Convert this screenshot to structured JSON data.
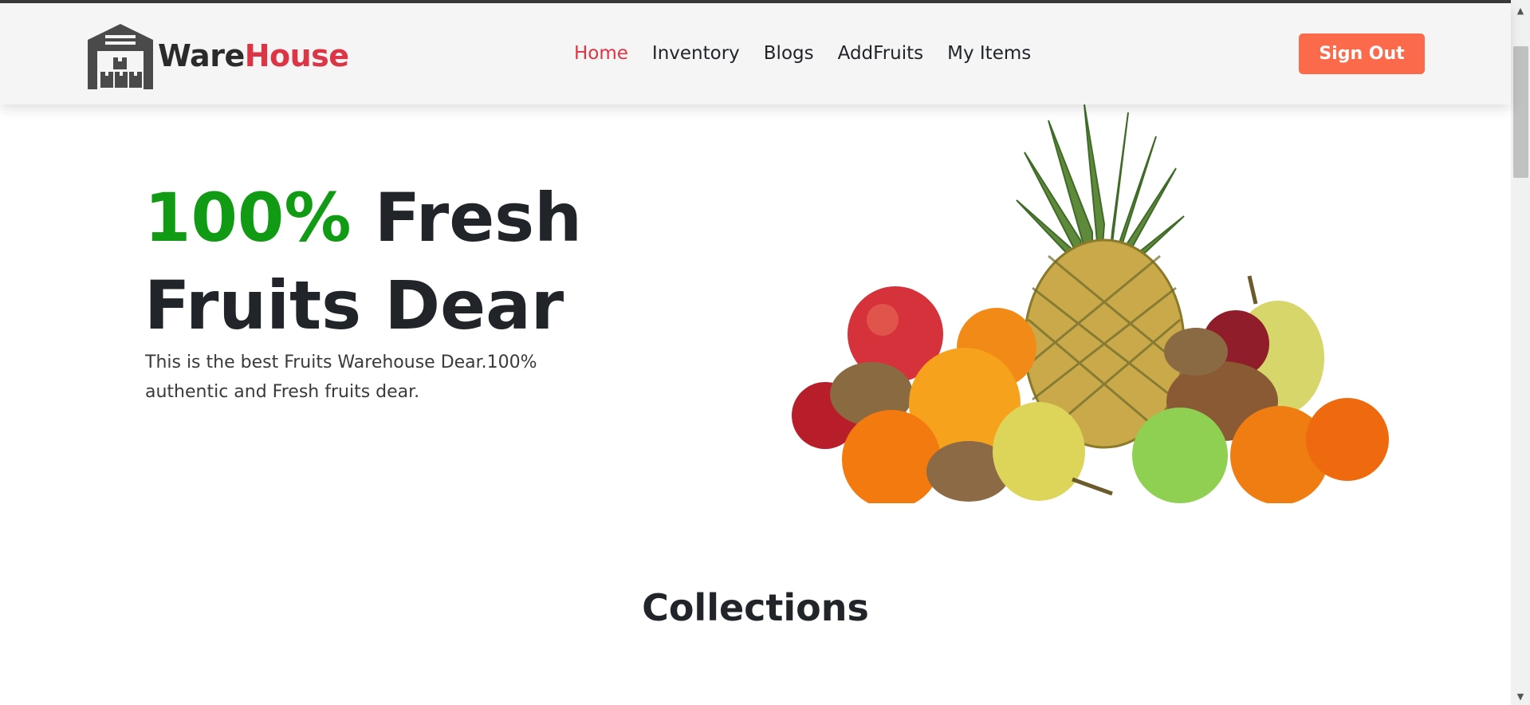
{
  "brand": {
    "name_part1": "Ware",
    "name_part2": "House",
    "logo_icon": "warehouse-icon"
  },
  "nav": {
    "items": [
      {
        "label": "Home",
        "active": true
      },
      {
        "label": "Inventory",
        "active": false
      },
      {
        "label": "Blogs",
        "active": false
      },
      {
        "label": "AddFruits",
        "active": false
      },
      {
        "label": "My Items",
        "active": false
      }
    ],
    "sign_out_label": "Sign Out"
  },
  "hero": {
    "title_accent": "100%",
    "title_rest": " Fresh",
    "title_line2": "Fruits Dear",
    "description": "This is the best Fruits Warehouse Dear.100% authentic and Fresh fruits dear.",
    "image": "fruit-assortment-image"
  },
  "collections": {
    "heading": "Collections"
  },
  "colors": {
    "accent_red": "#dc3545",
    "accent_green": "#119a13",
    "button_orange": "#fb6a4b",
    "navbar_bg": "#f5f5f5"
  }
}
